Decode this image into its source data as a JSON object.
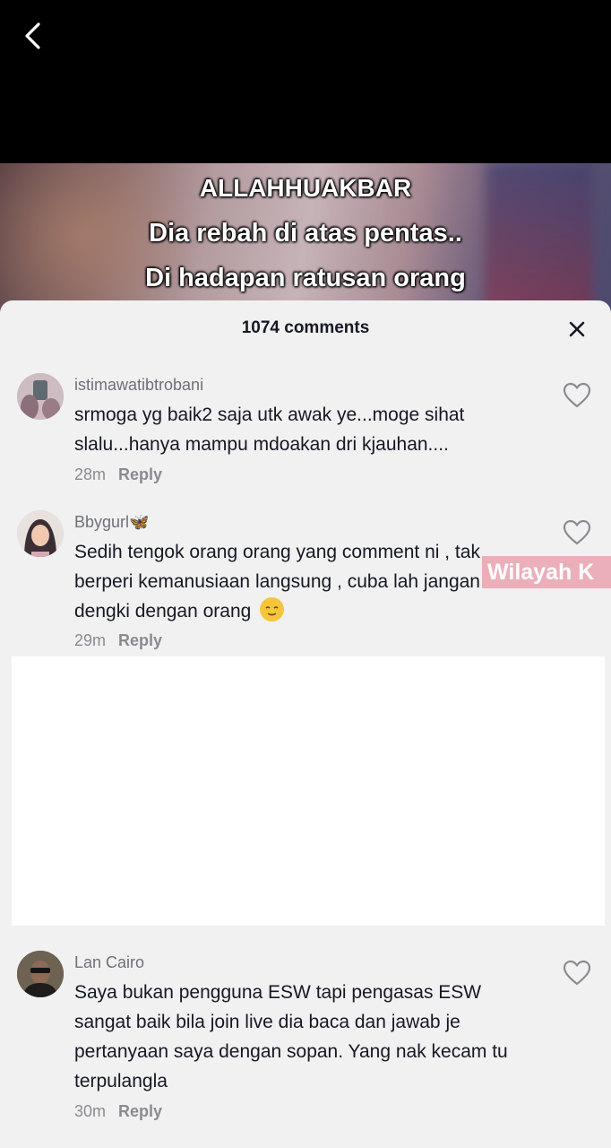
{
  "video": {
    "overlay_lines": [
      "ALLAHHUAKBAR",
      "Dia rebah di atas pentas..",
      "Di hadapan ratusan orang"
    ]
  },
  "comments_panel": {
    "count_label": "1074 comments"
  },
  "comments": [
    {
      "username": "istimawatibtrobani",
      "text": "srmoga yg baik2 saja utk awak ye...moge sihat slalu...hanya mampu mdoakan dri kjauhan....",
      "time": "28m",
      "reply_label": "Reply"
    },
    {
      "username": "Bbygurl🦋",
      "text": "Sedih tengok orang orang yang comment ni , tak berperi kemanusiaan langsung , cuba lah jangan dengki dengan orang",
      "emoji": "😌",
      "time": "29m",
      "reply_label": "Reply"
    },
    {
      "username": "Lan Cairo",
      "text": "Saya bukan pengguna ESW tapi pengasas ESW sangat baik bila join live dia baca dan jawab je pertanyaan saya dengan sopan. Yang nak kecam tu terpulangla",
      "time": "30m",
      "reply_label": "Reply"
    }
  ],
  "watermark": "Wilayah K",
  "icons": {
    "back": "chevron-left-icon",
    "close": "close-icon",
    "like": "heart-outline-icon"
  },
  "colors": {
    "sheet_bg": "#f1f1f2",
    "text": "#161823",
    "muted": "#8a8b91"
  }
}
